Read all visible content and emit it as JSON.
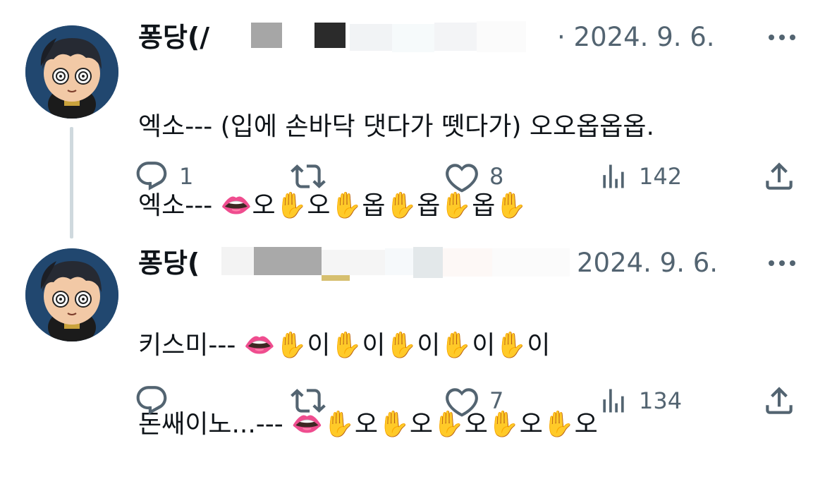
{
  "tweets": [
    {
      "display_name": "퐁당(/",
      "timestamp": "· 2024. 9. 6.",
      "text_lines": [
        "엑소--- (입에 손바닥 댓다가 뗏다가) 오오옵옵옵.",
        "엑소--- 👄오✋오✋옵✋옵✋옵✋"
      ],
      "counts": {
        "replies": "1",
        "retweets": "",
        "likes": "8",
        "views": "142"
      }
    },
    {
      "display_name": "퐁당(",
      "timestamp": "2024. 9. 6.",
      "text_lines": [
        "키스미--- 👄✋이✋이✋이✋이✋이",
        "돈쌔이노...--- 👄✋오✋오✋오✋오✋오"
      ],
      "counts": {
        "replies": "",
        "retweets": "",
        "likes": "7",
        "views": "134"
      }
    }
  ],
  "icons": {
    "reply": "reply-icon",
    "retweet": "retweet-icon",
    "like": "heart-icon",
    "views": "views-icon",
    "share": "share-icon",
    "more": "more-icon"
  },
  "colors": {
    "text": "#0f1419",
    "secondary": "#536471",
    "thread_line": "#cfd9de",
    "avatar_bg": "#21476f"
  }
}
